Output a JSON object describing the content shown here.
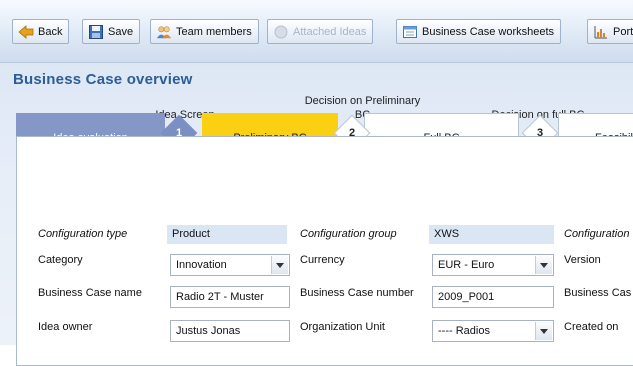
{
  "toolbar": {
    "back_label": "Back",
    "save_label": "Save",
    "team_label": "Team members",
    "ideas_label": "Attached Ideas",
    "worksheets_label": "Business Case worksheets",
    "port_label": "Port"
  },
  "page": {
    "title": "Business Case overview"
  },
  "stages": {
    "labels": {
      "idea_screen": "Idea Screen",
      "decision_preliminary": "Decision on Preliminary BC",
      "decision_full": "Decision on full BC"
    },
    "s1": "Idea evaluation",
    "s2": "Preliminary BC",
    "s3": "Full BC",
    "s4": "Feasibili",
    "d1": "1",
    "d2": "2",
    "d3": "3"
  },
  "form": {
    "config_type_label": "Configuration type",
    "config_type_value": "Product",
    "config_group_label": "Configuration group",
    "config_group_value": "XWS",
    "config_col3_label": "Configuration",
    "category_label": "Category",
    "category_value": "Innovation",
    "currency_label": "Currency",
    "currency_value": "EUR - Euro",
    "version_label": "Version",
    "bc_name_label": "Business Case name",
    "bc_name_value": "Radio 2T - Muster",
    "bc_number_label": "Business Case number",
    "bc_number_value": "2009_P001",
    "bc_col3_label": "Business Cas",
    "owner_label": "Idea owner",
    "owner_value": "Justus Jonas",
    "org_unit_label": "Organization Unit",
    "org_unit_value": "---- Radios",
    "created_label": "Created on"
  },
  "colors": {
    "title": "#2e5d96",
    "stage_done": "#8497c6",
    "stage_active": "#fbcf12",
    "diamond_done": "#7b8fc3"
  },
  "icons": [
    "back-arrow-icon",
    "save-disk-icon",
    "team-members-icon",
    "attached-ideas-icon",
    "worksheets-icon",
    "portfolio-chart-icon",
    "dropdown-arrow-icon"
  ]
}
